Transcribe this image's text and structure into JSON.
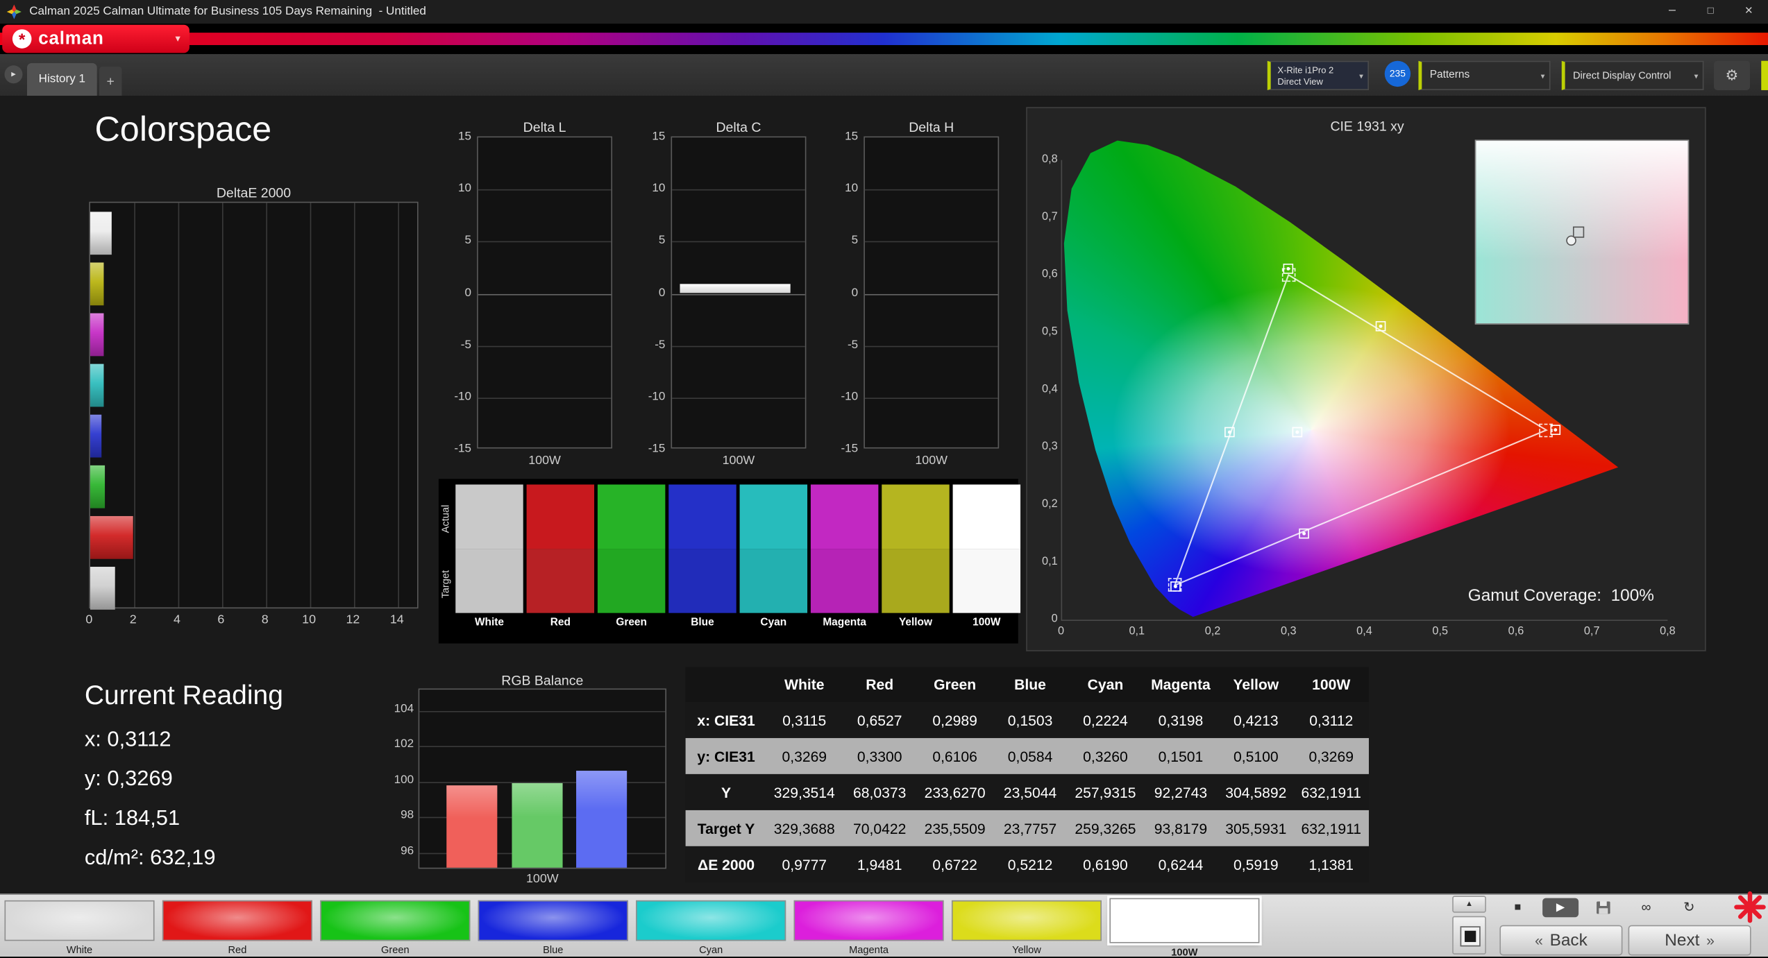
{
  "titlebar": {
    "title": "Calman 2025 Calman Ultimate for Business 105 Days Remaining  - Untitled",
    "minimize": "–",
    "maximize": "□",
    "close": "×"
  },
  "brand": {
    "logo_text": "calman",
    "logo_mark": "*",
    "caret": "▾"
  },
  "tabbar": {
    "scroll_icon": "▸",
    "history_tab": "History 1",
    "add_tab": "+",
    "meter_dropdown": {
      "line1": "X-Rite i1Pro 2",
      "line2": "Direct View",
      "caret": "▾"
    },
    "badge": "235",
    "patterns_dropdown": {
      "label": "Patterns",
      "caret": "▾"
    },
    "display_dropdown": {
      "label": "Direct Display Control",
      "caret": "▾"
    },
    "gear": "⚙"
  },
  "page_title": "Colorspace",
  "deltae_chart": {
    "title": "DeltaE 2000",
    "x_ticks": [
      "0",
      "2",
      "4",
      "6",
      "8",
      "10",
      "12",
      "14"
    ],
    "x_max": 14,
    "bars": [
      {
        "name": "White",
        "value": 0.9777,
        "color": "#ececec"
      },
      {
        "name": "Yellow",
        "value": 0.5919,
        "color": "#b9b411"
      },
      {
        "name": "Magenta",
        "value": 0.6244,
        "color": "#c52cc5"
      },
      {
        "name": "Cyan",
        "value": 0.619,
        "color": "#2fbdbd"
      },
      {
        "name": "Blue",
        "value": 0.5212,
        "color": "#2b36cf"
      },
      {
        "name": "Green",
        "value": 0.6722,
        "color": "#2eb52e"
      },
      {
        "name": "Red",
        "value": 1.9481,
        "color": "#d12020"
      },
      {
        "name": "100W",
        "value": 1.1381,
        "color": "#cfcfcf"
      }
    ]
  },
  "delta_axis_y_ticks": [
    "15",
    "10",
    "5",
    "0",
    "-5",
    "-10",
    "-15"
  ],
  "delta_charts": [
    {
      "title": "Delta L",
      "x_label": "100W",
      "bar_value": 0
    },
    {
      "title": "Delta C",
      "x_label": "100W",
      "bar_value": 0.9
    },
    {
      "title": "Delta H",
      "x_label": "100W",
      "bar_value": 0
    }
  ],
  "swatch_strip": {
    "row_labels": [
      "Actual",
      "Target"
    ],
    "columns": [
      {
        "label": "White",
        "actual": "#c9c9c9",
        "target": "#c5c5c5"
      },
      {
        "label": "Red",
        "actual": "#c8191e",
        "target": "#b72125"
      },
      {
        "label": "Green",
        "actual": "#27b327",
        "target": "#22a822"
      },
      {
        "label": "Blue",
        "actual": "#2430c8",
        "target": "#212cba"
      },
      {
        "label": "Cyan",
        "actual": "#27bcbc",
        "target": "#23b0b0"
      },
      {
        "label": "Magenta",
        "actual": "#c228c2",
        "target": "#b623b6"
      },
      {
        "label": "Yellow",
        "actual": "#b5b520",
        "target": "#a9a91d"
      },
      {
        "label": "100W",
        "actual": "#ffffff",
        "target": "#f8f8f8"
      }
    ]
  },
  "cie_chart": {
    "title": "CIE 1931 xy",
    "x_ticks": [
      "0",
      "0,1",
      "0,2",
      "0,3",
      "0,4",
      "0,5",
      "0,6",
      "0,7",
      "0,8"
    ],
    "y_ticks": [
      "0,8",
      "0,7",
      "0,6",
      "0,5",
      "0,4",
      "0,3",
      "0,2",
      "0,1",
      "0"
    ],
    "gamut_label": "Gamut Coverage:",
    "gamut_value": "100%",
    "triangle": [
      [
        0.64,
        0.33
      ],
      [
        0.3,
        0.6
      ],
      [
        0.15,
        0.06
      ]
    ],
    "points": [
      {
        "name": "white",
        "x": 0.3115,
        "y": 0.3269
      },
      {
        "name": "red",
        "x": 0.6527,
        "y": 0.33
      },
      {
        "name": "green",
        "x": 0.2989,
        "y": 0.6106
      },
      {
        "name": "blue",
        "x": 0.1503,
        "y": 0.0584
      },
      {
        "name": "cyan",
        "x": 0.2224,
        "y": 0.326
      },
      {
        "name": "magenta",
        "x": 0.3198,
        "y": 0.1501
      },
      {
        "name": "yellow",
        "x": 0.4213,
        "y": 0.51
      },
      {
        "name": "100w",
        "x": 0.3112,
        "y": 0.3269
      }
    ]
  },
  "current_reading": {
    "title": "Current Reading",
    "lines": [
      "x: 0,3112",
      "y: 0,3269",
      "fL: 184,51",
      "cd/m²: 632,19"
    ]
  },
  "rgb_balance": {
    "title": "RGB Balance",
    "x_label": "100W",
    "y_ticks": [
      104,
      102,
      100,
      98,
      96
    ],
    "bars": [
      {
        "name": "red",
        "value": 99.8,
        "color": "#f0605a"
      },
      {
        "name": "green",
        "value": 99.9,
        "color": "#66c966"
      },
      {
        "name": "blue",
        "value": 100.6,
        "color": "#5c6cf2"
      }
    ]
  },
  "measurement_table": {
    "columns": [
      "White",
      "Red",
      "Green",
      "Blue",
      "Cyan",
      "Magenta",
      "Yellow",
      "100W"
    ],
    "rows": [
      {
        "label": "x: CIE31",
        "values": [
          "0,3115",
          "0,6527",
          "0,2989",
          "0,1503",
          "0,2224",
          "0,3198",
          "0,4213",
          "0,3112"
        ]
      },
      {
        "label": "y: CIE31",
        "values": [
          "0,3269",
          "0,3300",
          "0,6106",
          "0,0584",
          "0,3260",
          "0,1501",
          "0,5100",
          "0,3269"
        ]
      },
      {
        "label": "Y",
        "values": [
          "329,3514",
          "68,0373",
          "233,6270",
          "23,5044",
          "257,9315",
          "92,2743",
          "304,5892",
          "632,1911"
        ]
      },
      {
        "label": "Target Y",
        "values": [
          "329,3688",
          "70,0422",
          "235,5509",
          "23,7757",
          "259,3265",
          "93,8179",
          "305,5931",
          "632,1911"
        ]
      },
      {
        "label": "ΔE 2000",
        "values": [
          "0,9777",
          "1,9481",
          "0,6722",
          "0,5212",
          "0,6190",
          "0,6244",
          "0,5919",
          "1,1381"
        ]
      }
    ]
  },
  "bottombar": {
    "swatch_buttons": [
      {
        "label": "White",
        "color": "#d9d9d9",
        "selected": false
      },
      {
        "label": "Red",
        "color": "#e11717",
        "selected": false
      },
      {
        "label": "Green",
        "color": "#17c317",
        "selected": false
      },
      {
        "label": "Blue",
        "color": "#1726dc",
        "selected": false
      },
      {
        "label": "Cyan",
        "color": "#1bcccc",
        "selected": false
      },
      {
        "label": "Magenta",
        "color": "#dc1fdc",
        "selected": false
      },
      {
        "label": "Yellow",
        "color": "#dcdc1b",
        "selected": false
      },
      {
        "label": "100W",
        "color": "#ffffff",
        "selected": true
      }
    ],
    "up_icon": "▲",
    "stop_icon": "■",
    "play_icon": "▶",
    "loop_icon": "∞",
    "refresh_icon": "↻",
    "back_icon": "«",
    "back_label": "Back",
    "next_label": "Next",
    "next_icon": "»"
  }
}
